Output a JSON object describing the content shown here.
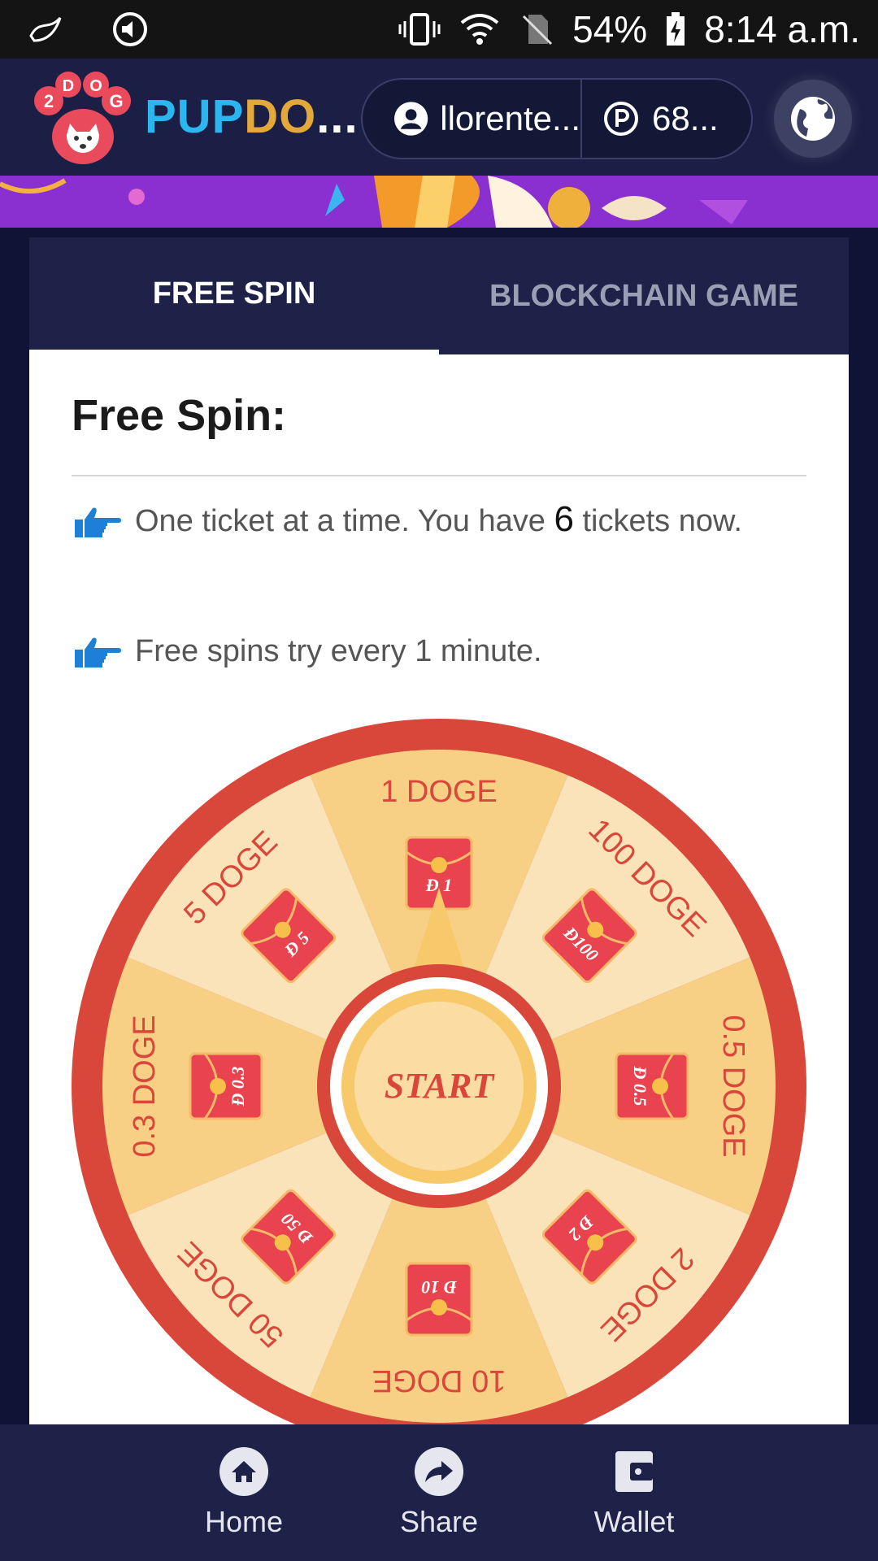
{
  "status_bar": {
    "battery": "54%",
    "time": "8:14 a.m."
  },
  "header": {
    "logo_letters": [
      "2",
      "D",
      "O",
      "G"
    ],
    "brand_part1": "PUP",
    "brand_part2": "DO",
    "brand_ellipsis": "...",
    "username": "llorente...",
    "points": "68..."
  },
  "tabs": [
    {
      "label": "FREE SPIN",
      "active": true
    },
    {
      "label": "BLOCKCHAIN GAME",
      "active": false
    }
  ],
  "content": {
    "title": "Free Spin:",
    "line1_prefix": "One ticket at a time. You have",
    "tickets": "6",
    "line1_suffix": "tickets now.",
    "line2": "Free spins try every 1 minute."
  },
  "wheel": {
    "start_label": "START",
    "segments": [
      {
        "label": "1 DOGE",
        "coin": "Đ 1"
      },
      {
        "label": "100 DOGE",
        "coin": "Đ100"
      },
      {
        "label": "0.5 DOGE",
        "coin": "Đ 0.5"
      },
      {
        "label": "2 DOGE",
        "coin": "Đ 2"
      },
      {
        "label": "10 DOGE",
        "coin": "Đ 10"
      },
      {
        "label": "50 DOGE",
        "coin": "Đ 50"
      },
      {
        "label": "0.3 DOGE",
        "coin": "Đ 0.3"
      },
      {
        "label": "5 DOGE",
        "coin": "Đ 5"
      }
    ]
  },
  "bottom_nav": [
    {
      "label": "Home",
      "icon": "home-icon"
    },
    {
      "label": "Share",
      "icon": "share-icon"
    },
    {
      "label": "Wallet",
      "icon": "wallet-icon"
    }
  ],
  "colors": {
    "header_bg": "#1b1f45",
    "accent_blue": "#2bb6ef",
    "accent_gold": "#e2a93a",
    "wheel_red": "#d9473a",
    "wheel_light": "#fbe3b9",
    "wheel_dark": "#f7cf85"
  }
}
